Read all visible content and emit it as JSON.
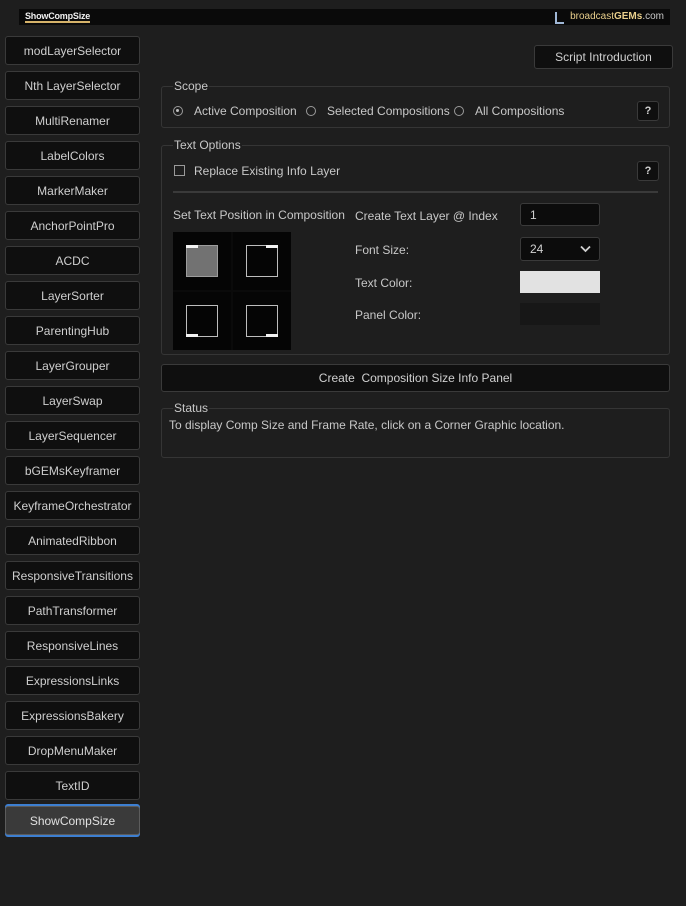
{
  "header": {
    "logo_left": "ShowCompSize",
    "logo_right_a": "broadcast",
    "logo_right_b": "GEMs",
    "logo_right_c": ".com"
  },
  "sidebar": {
    "items": [
      {
        "label": "modLayerSelector"
      },
      {
        "label": "Nth LayerSelector"
      },
      {
        "label": "MultiRenamer"
      },
      {
        "label": "LabelColors"
      },
      {
        "label": "MarkerMaker"
      },
      {
        "label": "AnchorPointPro"
      },
      {
        "label": "ACDC"
      },
      {
        "label": "LayerSorter"
      },
      {
        "label": "ParentingHub"
      },
      {
        "label": "LayerGrouper"
      },
      {
        "label": "LayerSwap"
      },
      {
        "label": "LayerSequencer"
      },
      {
        "label": "bGEMsKeyframer"
      },
      {
        "label": "KeyframeOrchestrator"
      },
      {
        "label": "AnimatedRibbon"
      },
      {
        "label": "ResponsiveTransitions"
      },
      {
        "label": "PathTransformer"
      },
      {
        "label": "ResponsiveLines"
      },
      {
        "label": "ExpressionsLinks"
      },
      {
        "label": "ExpressionsBakery"
      },
      {
        "label": "DropMenuMaker"
      },
      {
        "label": "TextID"
      },
      {
        "label": "ShowCompSize",
        "active": true
      }
    ]
  },
  "main": {
    "intro_button": "Script Introduction",
    "scope": {
      "title": "Scope",
      "options": [
        "Active Composition",
        "Selected Compositions",
        "All Compositions"
      ],
      "selected": "Active Composition",
      "help": "?"
    },
    "text_options": {
      "title": "Text Options",
      "replace_label": "Replace Existing Info Layer",
      "replace_checked": false,
      "help": "?",
      "position_label": "Set Text Position in Composition",
      "selected_corner": "top-left",
      "index_label": "Create Text Layer @ Index",
      "index_value": "1",
      "font_size_label": "Font Size:",
      "font_size_value": "24",
      "text_color_label": "Text Color:",
      "text_color": "#e2e2e2",
      "panel_color_label": "Panel Color:",
      "panel_color": "#171717"
    },
    "create_button": "Create  Composition Size Info Panel",
    "status": {
      "title": "Status",
      "text": "To display Comp Size and Frame Rate, click on a Corner Graphic location."
    }
  },
  "colors": {
    "accent": "#3d7fd1",
    "brand_gold": "#d6b36a"
  }
}
